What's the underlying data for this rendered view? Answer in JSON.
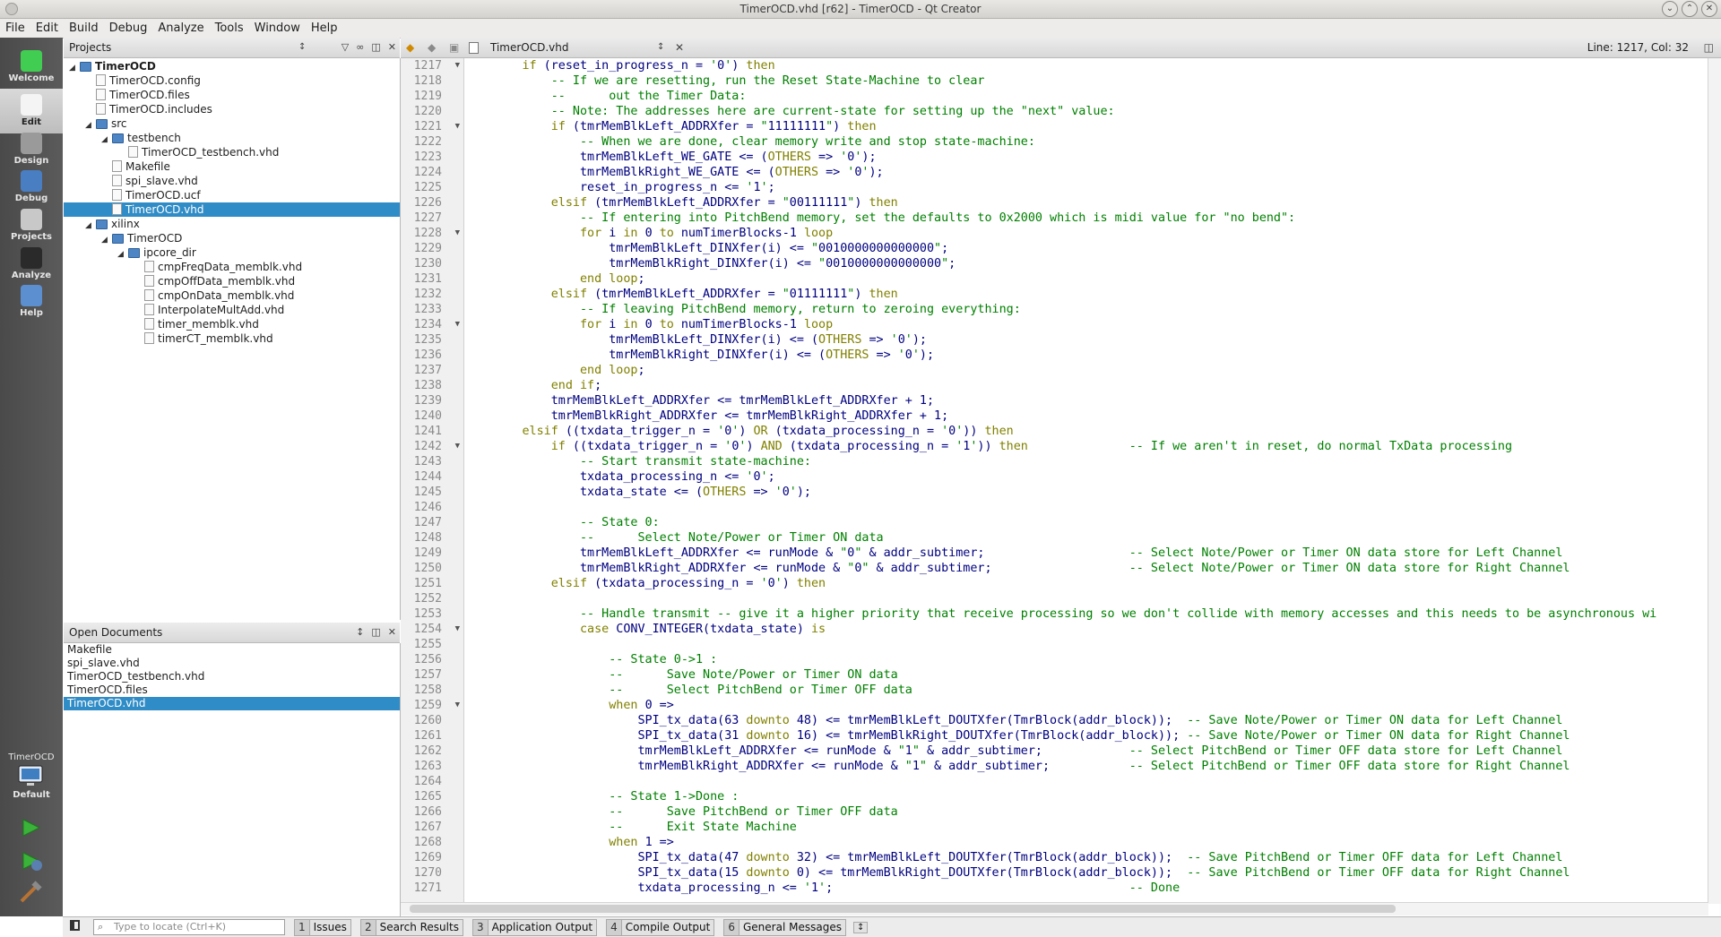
{
  "window": {
    "title": "TimerOCD.vhd [r62] - TimerOCD - Qt Creator"
  },
  "menu": [
    "File",
    "Edit",
    "Build",
    "Debug",
    "Analyze",
    "Tools",
    "Window",
    "Help"
  ],
  "modes": [
    {
      "label": "Welcome",
      "icon": "qt-logo-icon",
      "active": false
    },
    {
      "label": "Edit",
      "icon": "edit-document-icon",
      "active": true
    },
    {
      "label": "Design",
      "icon": "design-pencil-icon",
      "active": false
    },
    {
      "label": "Debug",
      "icon": "debug-bug-icon",
      "active": false
    },
    {
      "label": "Projects",
      "icon": "projects-wrench-icon",
      "active": false
    },
    {
      "label": "Analyze",
      "icon": "analyze-chart-icon",
      "active": false
    },
    {
      "label": "Help",
      "icon": "help-question-icon",
      "active": false
    }
  ],
  "kit": {
    "project": "TimerOCD",
    "config": "Default"
  },
  "projects_panel": {
    "title": "Projects",
    "tree": [
      {
        "label": "TimerOCD",
        "depth": 0,
        "type": "folder",
        "expanded": true,
        "bold": true
      },
      {
        "label": "TimerOCD.config",
        "depth": 1,
        "type": "file"
      },
      {
        "label": "TimerOCD.files",
        "depth": 1,
        "type": "file"
      },
      {
        "label": "TimerOCD.includes",
        "depth": 1,
        "type": "file"
      },
      {
        "label": "src",
        "depth": 1,
        "type": "folder",
        "expanded": true
      },
      {
        "label": "testbench",
        "depth": 2,
        "type": "folder",
        "expanded": true
      },
      {
        "label": "TimerOCD_testbench.vhd",
        "depth": 3,
        "type": "file"
      },
      {
        "label": "Makefile",
        "depth": 2,
        "type": "file"
      },
      {
        "label": "spi_slave.vhd",
        "depth": 2,
        "type": "file"
      },
      {
        "label": "TimerOCD.ucf",
        "depth": 2,
        "type": "file"
      },
      {
        "label": "TimerOCD.vhd",
        "depth": 2,
        "type": "file",
        "selected": true
      },
      {
        "label": "xilinx",
        "depth": 1,
        "type": "folder",
        "expanded": true
      },
      {
        "label": "TimerOCD",
        "depth": 2,
        "type": "folder",
        "expanded": true
      },
      {
        "label": "ipcore_dir",
        "depth": 3,
        "type": "folder",
        "expanded": true
      },
      {
        "label": "cmpFreqData_memblk.vhd",
        "depth": 4,
        "type": "file"
      },
      {
        "label": "cmpOffData_memblk.vhd",
        "depth": 4,
        "type": "file"
      },
      {
        "label": "cmpOnData_memblk.vhd",
        "depth": 4,
        "type": "file"
      },
      {
        "label": "InterpolateMultAdd.vhd",
        "depth": 4,
        "type": "file"
      },
      {
        "label": "timer_memblk.vhd",
        "depth": 4,
        "type": "file"
      },
      {
        "label": "timerCT_memblk.vhd",
        "depth": 4,
        "type": "file"
      }
    ]
  },
  "open_documents": {
    "title": "Open Documents",
    "items": [
      {
        "label": "Makefile"
      },
      {
        "label": "spi_slave.vhd"
      },
      {
        "label": "TimerOCD_testbench.vhd"
      },
      {
        "label": "TimerOCD.files"
      },
      {
        "label": "TimerOCD.vhd",
        "selected": true
      }
    ]
  },
  "editor": {
    "file": "TimerOCD.vhd",
    "position": "Line: 1217, Col: 32",
    "first_line": 1217,
    "fold_lines": [
      1217,
      1221,
      1228,
      1234,
      1242,
      1254,
      1259
    ],
    "lines": [
      "        if (reset_in_progress_n = '0') then",
      "            -- If we are resetting, run the Reset State-Machine to clear",
      "            --      out the Timer Data:",
      "            -- Note: The addresses here are current-state for setting up the \"next\" value:",
      "            if (tmrMemBlkLeft_ADDRXfer = \"11111111\") then",
      "                -- When we are done, clear memory write and stop state-machine:",
      "                tmrMemBlkLeft_WE_GATE <= (OTHERS => '0');",
      "                tmrMemBlkRight_WE_GATE <= (OTHERS => '0');",
      "                reset_in_progress_n <= '1';",
      "            elsif (tmrMemBlkLeft_ADDRXfer = \"00111111\") then",
      "                -- If entering into PitchBend memory, set the defaults to 0x2000 which is midi value for \"no bend\":",
      "                for i in 0 to numTimerBlocks-1 loop",
      "                    tmrMemBlkLeft_DINXfer(i) <= \"0010000000000000\";",
      "                    tmrMemBlkRight_DINXfer(i) <= \"0010000000000000\";",
      "                end loop;",
      "            elsif (tmrMemBlkLeft_ADDRXfer = \"01111111\") then",
      "                -- If leaving PitchBend memory, return to zeroing everything:",
      "                for i in 0 to numTimerBlocks-1 loop",
      "                    tmrMemBlkLeft_DINXfer(i) <= (OTHERS => '0');",
      "                    tmrMemBlkRight_DINXfer(i) <= (OTHERS => '0');",
      "                end loop;",
      "            end if;",
      "            tmrMemBlkLeft_ADDRXfer <= tmrMemBlkLeft_ADDRXfer + 1;",
      "            tmrMemBlkRight_ADDRXfer <= tmrMemBlkRight_ADDRXfer + 1;",
      "        elsif ((txdata_trigger_n = '0') OR (txdata_processing_n = '0')) then",
      "            if ((txdata_trigger_n = '0') AND (txdata_processing_n = '1')) then              -- If we aren't in reset, do normal TxData processing",
      "                -- Start transmit state-machine:",
      "                txdata_processing_n <= '0';",
      "                txdata_state <= (OTHERS => '0');",
      "",
      "                -- State 0:",
      "                --      Select Note/Power or Timer ON data",
      "                tmrMemBlkLeft_ADDRXfer <= runMode & \"0\" & addr_subtimer;                    -- Select Note/Power or Timer ON data store for Left Channel",
      "                tmrMemBlkRight_ADDRXfer <= runMode & \"0\" & addr_subtimer;                   -- Select Note/Power or Timer ON data store for Right Channel",
      "            elsif (txdata_processing_n = '0') then",
      "",
      "                -- Handle transmit -- give it a higher priority that receive processing so we don't collide with memory accesses and this needs to be asynchronous wi",
      "                case CONV_INTEGER(txdata_state) is",
      "",
      "                    -- State 0->1 :",
      "                    --      Save Note/Power or Timer ON data",
      "                    --      Select PitchBend or Timer OFF data",
      "                    when 0 =>",
      "                        SPI_tx_data(63 downto 48) <= tmrMemBlkLeft_DOUTXfer(TmrBlock(addr_block));  -- Save Note/Power or Timer ON data for Left Channel",
      "                        SPI_tx_data(31 downto 16) <= tmrMemBlkRight_DOUTXfer(TmrBlock(addr_block)); -- Save Note/Power or Timer ON data for Right Channel",
      "                        tmrMemBlkLeft_ADDRXfer <= runMode & \"1\" & addr_subtimer;            -- Select PitchBend or Timer OFF data store for Left Channel",
      "                        tmrMemBlkRight_ADDRXfer <= runMode & \"1\" & addr_subtimer;           -- Select PitchBend or Timer OFF data store for Right Channel",
      "",
      "                    -- State 1->Done :",
      "                    --      Save PitchBend or Timer OFF data",
      "                    --      Exit State Machine",
      "                    when 1 =>",
      "                        SPI_tx_data(47 downto 32) <= tmrMemBlkLeft_DOUTXfer(TmrBlock(addr_block));  -- Save PitchBend or Timer OFF data for Left Channel",
      "                        SPI_tx_data(15 downto 0) <= tmrMemBlkRight_DOUTXfer(TmrBlock(addr_block));  -- Save PitchBend or Timer OFF data for Right Channel",
      "                        txdata_processing_n <= '1';                                         -- Done"
    ]
  },
  "statusbar": {
    "locator_placeholder": "Type to locate (Ctrl+K)",
    "panes": [
      {
        "num": "1",
        "label": "Issues"
      },
      {
        "num": "2",
        "label": "Search Results"
      },
      {
        "num": "3",
        "label": "Application Output"
      },
      {
        "num": "4",
        "label": "Compile Output"
      },
      {
        "num": "6",
        "label": "General Messages"
      }
    ]
  },
  "colors": {
    "selection": "#308cc6",
    "keyword": "#808000",
    "comment": "#008000",
    "string": "#008000",
    "identifier": "#000080"
  }
}
